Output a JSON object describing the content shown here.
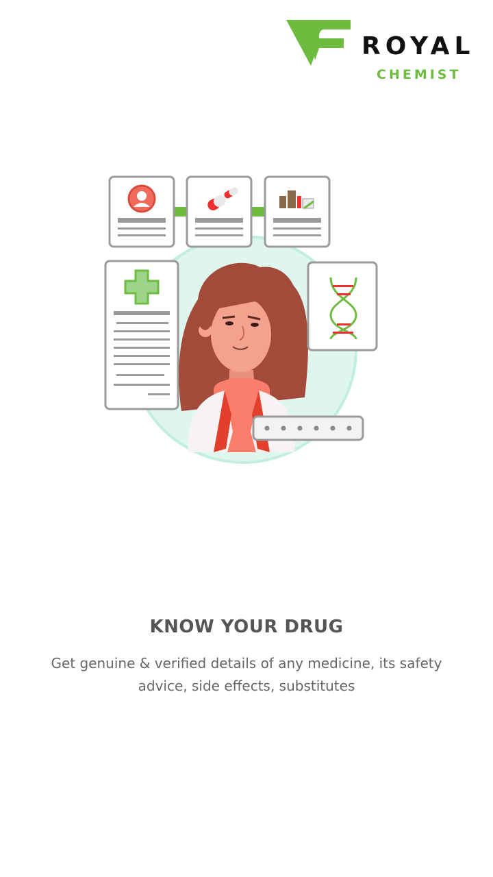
{
  "logo": {
    "name": "ROYAL",
    "sub": "CHEMIST"
  },
  "content": {
    "title": "KNOW YOUR DRUG",
    "description": "Get genuine & verified details of any medicine, its safety advice, side effects, substitutes"
  },
  "illustration": {
    "icons": [
      "person-profile-icon",
      "pill-capsule-icon",
      "medicine-bottles-icon",
      "medical-cross-icon",
      "dna-icon",
      "password-dots-icon"
    ]
  },
  "colors": {
    "brand_green": "#6dbb3f",
    "text_gray": "#555555",
    "hair": "#a34b3a",
    "circle": "#dff6ef"
  }
}
